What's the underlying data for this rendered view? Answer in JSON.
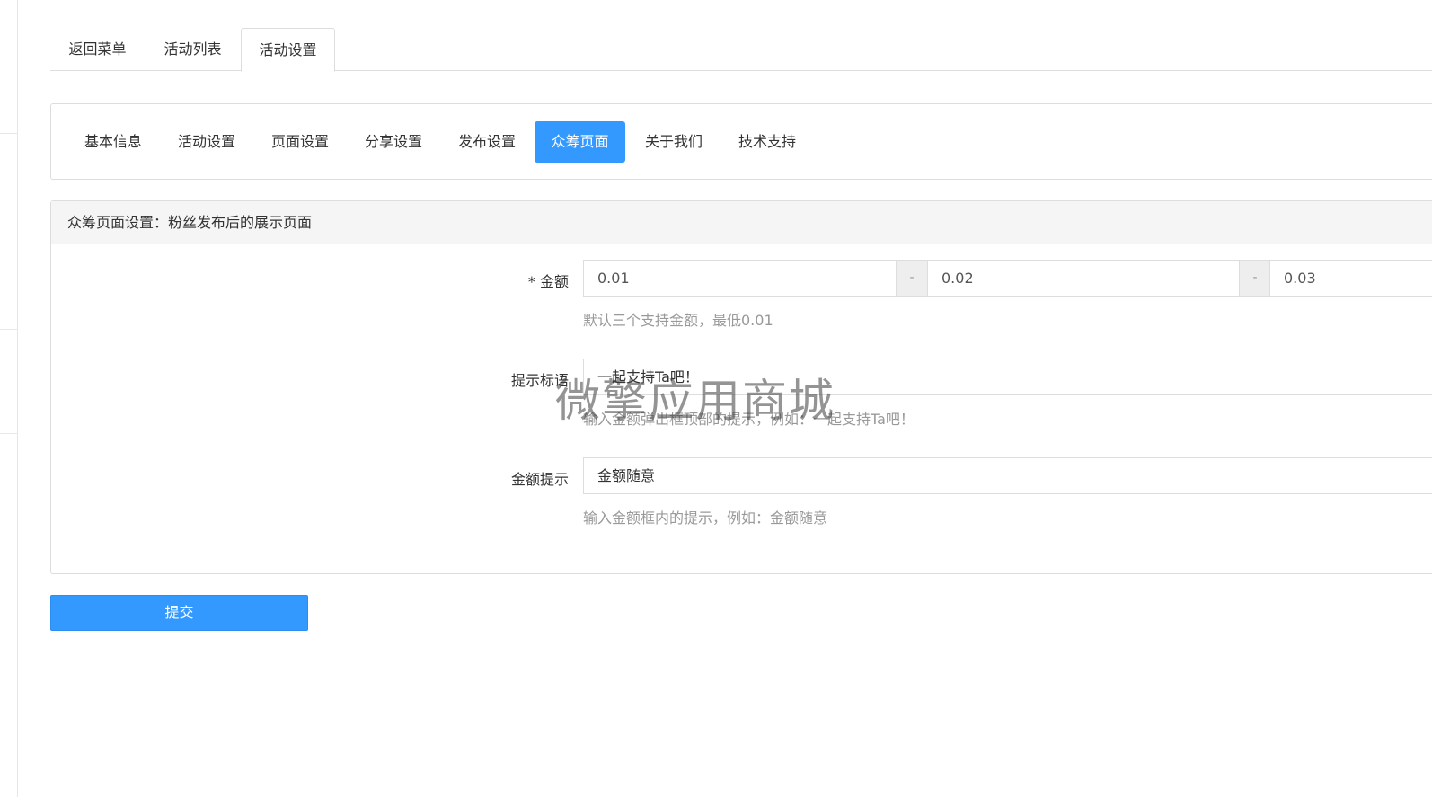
{
  "top_tabs": [
    {
      "label": "返回菜单"
    },
    {
      "label": "活动列表"
    },
    {
      "label": "活动设置",
      "active": true
    }
  ],
  "sub_nav": [
    {
      "label": "基本信息"
    },
    {
      "label": "活动设置"
    },
    {
      "label": "页面设置"
    },
    {
      "label": "分享设置"
    },
    {
      "label": "发布设置"
    },
    {
      "label": "众筹页面",
      "active": true
    },
    {
      "label": "关于我们"
    },
    {
      "label": "技术支持"
    }
  ],
  "panel": {
    "heading": "众筹页面设置：粉丝发布后的展示页面",
    "amount": {
      "label": "* 金额",
      "values": [
        "0.01",
        "0.02",
        "0.03"
      ],
      "separator": "-",
      "help": "默认三个支持金额，最低0.01"
    },
    "slogan": {
      "label": "提示标语",
      "value": "一起支持Ta吧！",
      "help": "输入金额弹出框顶部的提示，例如：一起支持Ta吧！"
    },
    "amount_hint": {
      "label": "金额提示",
      "value": "金额随意",
      "help": "输入金额框内的提示，例如：金额随意"
    }
  },
  "submit_label": "提交",
  "watermark": "微擎应用商城",
  "colors": {
    "accent": "#3399ff",
    "border": "#dddddd",
    "heading_bg": "#f5f5f5",
    "help_text": "#999999"
  }
}
